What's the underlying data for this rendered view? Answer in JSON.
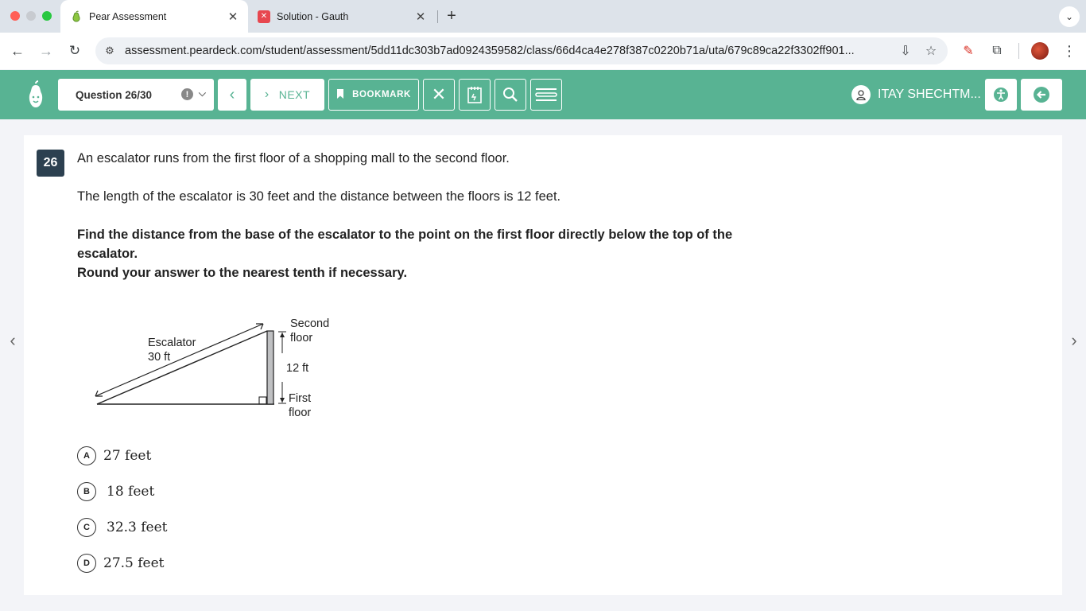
{
  "browser": {
    "tabs": [
      {
        "title": "Pear Assessment",
        "icon": "pear-icon",
        "active": true
      },
      {
        "title": "Solution - Gauth",
        "icon": "gauth-icon",
        "active": false
      }
    ],
    "url": "assessment.peardeck.com/student/assessment/5dd11dc303b7ad0924359582/class/66d4ca4e278f387c0220b71a/uta/679c89ca22f3302ff901..."
  },
  "header": {
    "question_selector": "Question 26/30",
    "next_label": "NEXT",
    "bookmark_label": "BOOKMARK",
    "user_name": "ITAY SHECHTM...",
    "accent_color": "#58b393"
  },
  "question": {
    "number": "26",
    "line1": "An escalator runs from the first floor of a shopping mall to the second floor.",
    "line2": "The length of the escalator is 30 feet and the distance between the floors is 12 feet.",
    "instruction": "Find the distance from the base of the escalator to the point on the first floor directly below the top of the escalator.",
    "instruction2": "Round your answer to the nearest tenth if necessary.",
    "diagram": {
      "escalator_label": "Escalator",
      "escalator_length": "30 ft",
      "second_floor_1": "Second",
      "second_floor_2": "floor",
      "height_label": "12 ft",
      "first_floor_1": "First",
      "first_floor_2": "floor"
    },
    "choices": [
      {
        "letter": "A",
        "text": "27 feet"
      },
      {
        "letter": "B",
        "text": "18 feet"
      },
      {
        "letter": "C",
        "text": "32.3 feet"
      },
      {
        "letter": "D",
        "text": "27.5 feet"
      }
    ]
  }
}
